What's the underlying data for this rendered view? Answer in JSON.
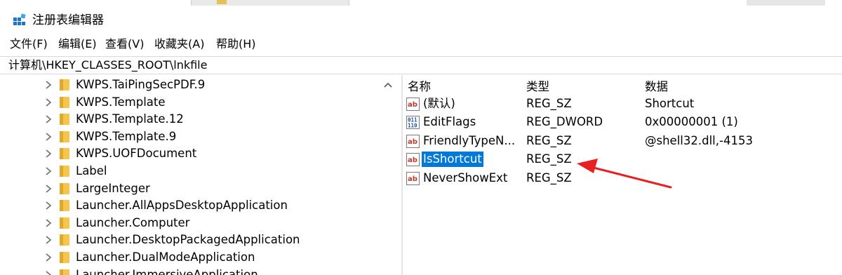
{
  "window": {
    "title": "注册表编辑器"
  },
  "menu": [
    "文件(F)",
    "编辑(E)",
    "查看(V)",
    "收藏夹(A)",
    "帮助(H)"
  ],
  "address": "计算机\\HKEY_CLASSES_ROOT\\lnkfile",
  "tree": [
    "KWPS.TaiPingSecPDF.9",
    "KWPS.Template",
    "KWPS.Template.12",
    "KWPS.Template.9",
    "KWPS.UOFDocument",
    "Label",
    "LargeInteger",
    "Launcher.AllAppsDesktopApplication",
    "Launcher.Computer",
    "Launcher.DesktopPackagedApplication",
    "Launcher.DualModeApplication",
    "Launcher.ImmersiveApplication"
  ],
  "columns": {
    "name": "名称",
    "type": "类型",
    "data": "数据"
  },
  "values": [
    {
      "name": "(默认)",
      "type": "REG_SZ",
      "data": "Shortcut",
      "icon": "string-value-icon"
    },
    {
      "name": "EditFlags",
      "type": "REG_DWORD",
      "data": "0x00000001 (1)",
      "icon": "binary-value-icon"
    },
    {
      "name": "FriendlyTypeN...",
      "type": "REG_SZ",
      "data": "@shell32.dll,-4153",
      "icon": "string-value-icon"
    },
    {
      "name": "IsShortcut",
      "type": "REG_SZ",
      "data": "",
      "icon": "string-value-icon",
      "selected": true
    },
    {
      "name": "NeverShowExt",
      "type": "REG_SZ",
      "data": "",
      "icon": "string-value-icon"
    }
  ],
  "colors": {
    "selection": "#0078d7",
    "annotation_arrow": "#e8201f",
    "folder": "#f5c64b"
  }
}
